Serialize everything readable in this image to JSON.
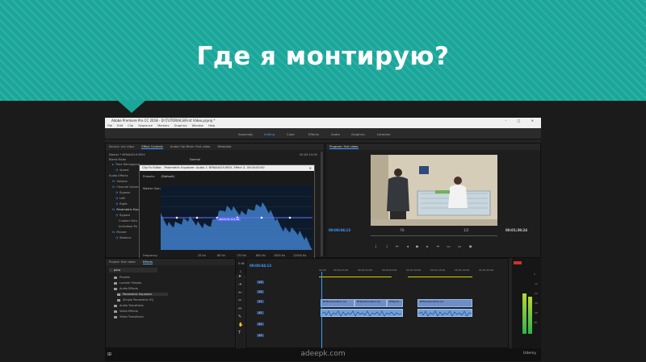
{
  "slide": {
    "title": "Где я монтирую?",
    "banner_color": "#1aa79a"
  },
  "app": {
    "window_title": "Adobe Premiere Pro CC 2018 - D:\\TUTORIALS\\First Video.prproj *",
    "menu": [
      "File",
      "Edit",
      "Clip",
      "Sequence",
      "Markers",
      "Graphics",
      "Window",
      "Help"
    ],
    "workspaces": [
      "Assembly",
      "Editing",
      "Color",
      "Effects",
      "Audio",
      "Graphics",
      "Libraries"
    ],
    "active_workspace": "Editing",
    "accent_color": "#3f9dff"
  },
  "effect_controls": {
    "tabs": [
      "Source: (no clips)",
      "Effect Controls",
      "Audio Clip Mixer: first video",
      "Metadata"
    ],
    "active_tab": "Effect Controls",
    "header": "Master * BFNA4419.MOV",
    "timecode": "00:00:15:00",
    "blend_mode_label": "Blend Mode",
    "blend_mode_value": "Normal",
    "rows": [
      {
        "label": "Time Remapping"
      },
      {
        "label": "Speed"
      },
      {
        "label": "Audio Effects"
      },
      {
        "label": "Volume"
      },
      {
        "label": "Channel Volume"
      },
      {
        "label": "Bypass"
      },
      {
        "label": "Left"
      },
      {
        "label": "Right"
      },
      {
        "label": "Parametric Equ"
      },
      {
        "label": "Bypass"
      },
      {
        "label": "Custom Setu"
      },
      {
        "label": "Individual Pa"
      },
      {
        "label": "Panner"
      },
      {
        "label": "Balance"
      }
    ]
  },
  "eq_dialog": {
    "title": "Clip Fx Editor - Parametric Equalizer: Audio 1: BFNA4419.MOV, Effect 3, 00:00:00:00",
    "presets_label": "Presets:",
    "presets_value": "(Default)",
    "master_gain_label": "Master Gain",
    "graph_readout": "283.6 Hz -6.4 dB",
    "frequency_label": "Frequency:",
    "gain_label": "Gain:",
    "q_label": "Q / Width:",
    "band_freqs": [
      "25 Hz",
      "60 Hz",
      "170 Hz",
      "600 Hz",
      "1000 Hz",
      "12000 Hz"
    ],
    "band_gains": [
      "0 dB",
      "0 dB",
      "0 dB",
      "0 dB",
      "0 dB",
      "0 dB"
    ],
    "band_q": [
      "2",
      "2",
      "2",
      "2",
      "2",
      "2"
    ]
  },
  "program_monitor": {
    "title": "Program: first video",
    "timecode_in": "00:00:04:13",
    "zoom": "Fit",
    "quality": "1/2",
    "timecode_out": "00:01:39:24"
  },
  "project": {
    "tabs": [
      "Project: first video",
      "Effects"
    ],
    "search_value": "para",
    "items": [
      {
        "label": "Presets"
      },
      {
        "label": "Lumetri Presets"
      },
      {
        "label": "Audio Effects"
      },
      {
        "label": "Parametric Equalizer"
      },
      {
        "label": "Simple Parametric EQ"
      },
      {
        "label": "Audio Transitions"
      },
      {
        "label": "Video Effects"
      },
      {
        "label": "Video Transitions"
      }
    ]
  },
  "timeline": {
    "timecode": "00:00:04:13",
    "ruler": [
      "00:00",
      "00:00:15:00",
      "00:00:30:00",
      "00:00:45:00",
      "00:01:00:00",
      "00:01:15:00",
      "00:01:30:00",
      "00:01:45:00"
    ],
    "tracks": [
      {
        "name": "V3"
      },
      {
        "name": "V2"
      },
      {
        "name": "V1"
      },
      {
        "name": "A1"
      },
      {
        "name": "A2"
      },
      {
        "name": "A3"
      }
    ],
    "video_clips": [
      "BFNA4419.MOV [V]",
      "BFNA4419.MOV [V]",
      "BFNA44...",
      "BFNA4419.MOV [V]"
    ]
  },
  "meters": {
    "scale": [
      "0",
      "-12",
      "-24",
      "-36",
      "-48",
      "dB"
    ],
    "level_left": 0.62,
    "level_right": 0.58
  },
  "footer": {
    "watermark": "adeepk.com",
    "brand": "Udemy"
  }
}
